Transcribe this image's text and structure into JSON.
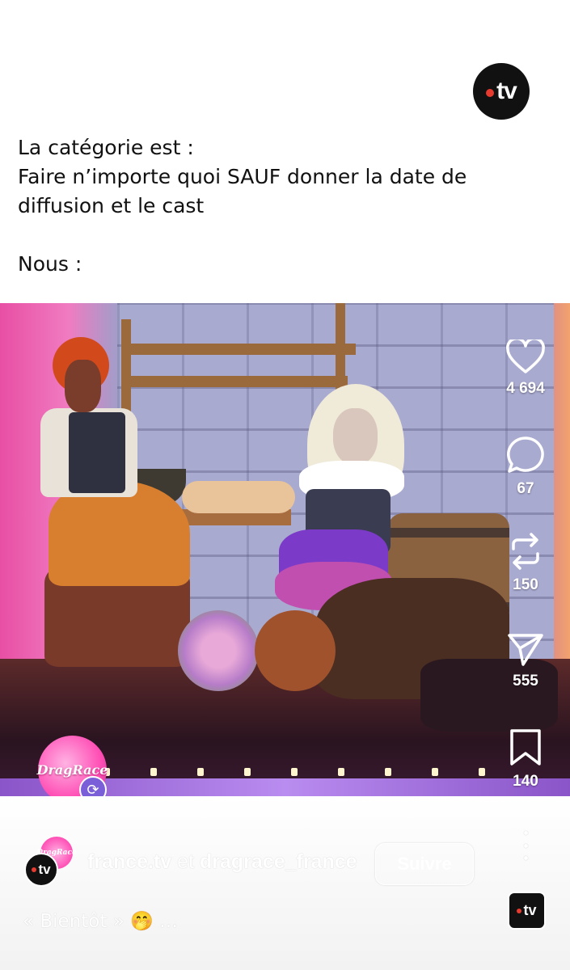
{
  "header": {
    "logo_text": "tv",
    "logo_dot_color": "#e63b2e"
  },
  "post_text": {
    "line1": "La catégorie est :",
    "line2": "Faire n’importe quoi SAUF donner la date de",
    "line3": "diffusion et le cast",
    "line4": "Nous :"
  },
  "actions": {
    "like_icon": "heart-icon",
    "likes": "4 694",
    "comment_icon": "comment-icon",
    "comments": "67",
    "repost_icon": "repost-icon",
    "reposts": "150",
    "share_icon": "send-icon",
    "shares": "555",
    "save_icon": "bookmark-icon",
    "saves": "140"
  },
  "collab_logo": {
    "text": "DragRace",
    "badge_icon": "collab-sync-icon"
  },
  "footer": {
    "avatar_text": "tv",
    "avatar2_text": "DragRace",
    "author1": "france.tv",
    "connector": "et",
    "author2": "dragrace_france",
    "follow_label": "Suivre",
    "caption": "« Bientôt » 🤭 …",
    "audio_text": "tv"
  }
}
